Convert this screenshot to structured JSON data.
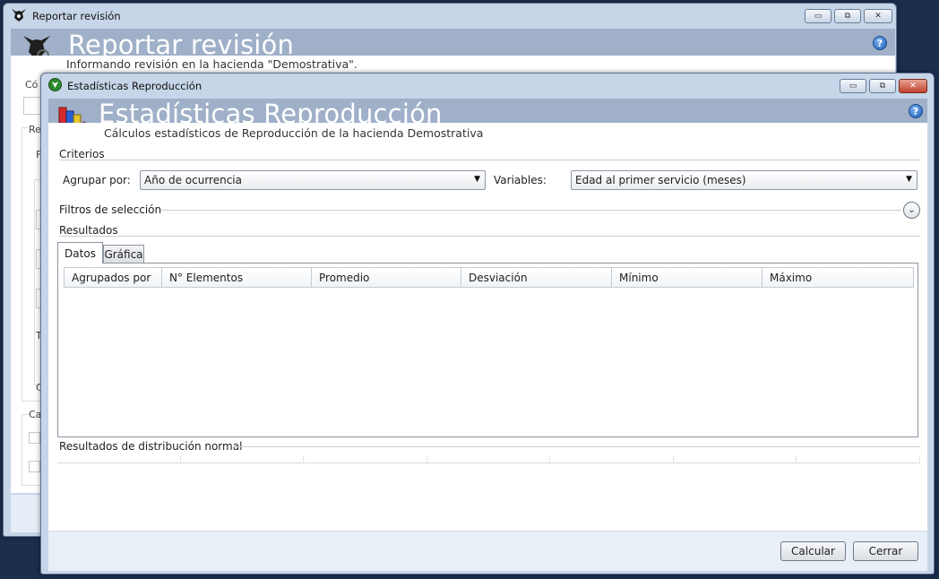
{
  "back_window": {
    "title": "Reportar revisión",
    "header_title": "Reportar revisión",
    "subtitle": "Informando revisión en la hacienda \"Demostrativa\".",
    "partial_labels": [
      "Có",
      "Re",
      "F",
      "T",
      "C",
      "Ca"
    ]
  },
  "front_window": {
    "title": "Estadísticas Reproducción",
    "header_title": "Estadísticas Reproducción",
    "subtitle": "Cálculos estadísticos de Reproducción de la hacienda Demostrativa",
    "criterios": {
      "section_label": "Criterios",
      "agrupar_label": "Agrupar por:",
      "agrupar_value": "Año de ocurrencia",
      "variables_label": "Variables:",
      "variables_value": "Edad al primer servicio (meses)"
    },
    "filtros_label": "Filtros de selección",
    "resultados_label": "Resultados",
    "tabs": [
      {
        "label": "Datos",
        "active": true
      },
      {
        "label": "Gráfica",
        "active": false
      }
    ],
    "grid_columns": [
      "Agrupados por",
      "N° Elementos",
      "Promedio",
      "Desviación",
      "Mínimo",
      "Máximo"
    ],
    "distribucion_label": "Resultados de distribución normal",
    "buttons": {
      "calcular": "Calcular",
      "cerrar": "Cerrar"
    }
  },
  "window_controls": {
    "minimize": "▭",
    "restore": "⧉",
    "close": "✕"
  },
  "help_glyph": "?",
  "colors": {
    "desktop": "#1b2e4d",
    "chrome": "#c6d5e8",
    "header_band": "#9fb0c8",
    "close_red": "#c0412c"
  }
}
